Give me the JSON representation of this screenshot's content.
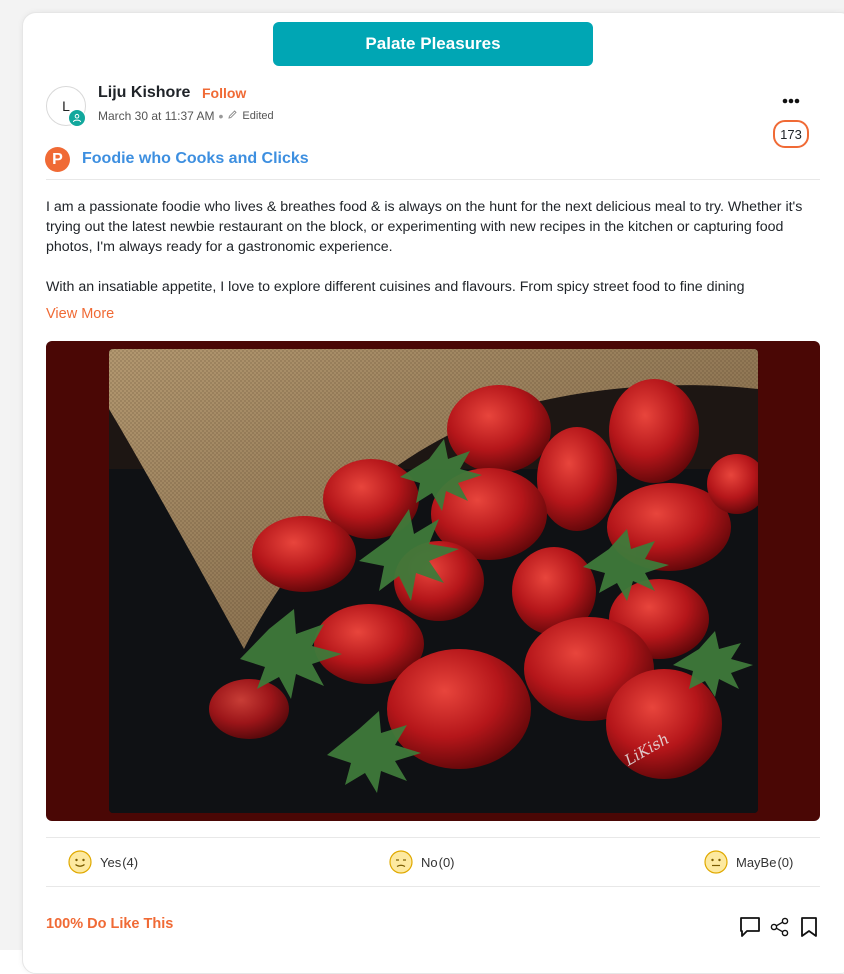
{
  "group": {
    "title": "Palate Pleasures",
    "color": "#00a6b4"
  },
  "post": {
    "author": {
      "name": "Liju Kishore",
      "initial": "L",
      "follow_label": "Follow"
    },
    "timestamp": "March 30 at 11:37 AM",
    "edited_label": "Edited",
    "view_count": "173",
    "profile": {
      "icon_letter": "P",
      "title": "Foodie who Cooks and Clicks"
    },
    "body_paragraphs": [
      "I am a passionate foodie who lives & breathes food & is always on the hunt for the next delicious meal to try. Whether it's trying out the latest newbie restaurant on the block, or experimenting with new recipes in the kitchen or capturing food photos, I'm always ready for a gastronomic experience.",
      "With an insatiable appetite, I love to explore  different cuisines and flavours. From spicy street food to fine dining"
    ],
    "view_more_label": "View More",
    "image": {
      "icon": "strawberries-photo",
      "watermark": "LiKish"
    }
  },
  "reactions": {
    "yes": {
      "label": "Yes",
      "count": "(4)"
    },
    "no": {
      "label": "No",
      "count": "(0)"
    },
    "maybe": {
      "label": "MayBe",
      "count": "(0)"
    }
  },
  "summary": "100% Do Like This",
  "actions": {
    "comment_icon": "comment-icon",
    "share_icon": "share-icon",
    "bookmark_icon": "bookmark-icon"
  },
  "colors": {
    "accent": "#f06a35",
    "link_blue": "#3d8fe0",
    "image_border": "#4a0705"
  }
}
